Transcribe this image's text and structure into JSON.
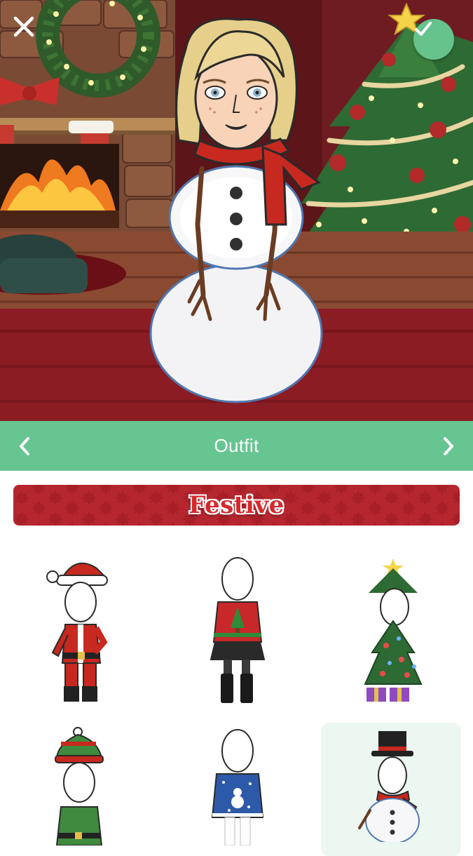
{
  "header": {
    "close_icon": "close-icon",
    "confirm_icon": "checkmark-icon",
    "accent_color": "#66c38b"
  },
  "category_bar": {
    "title": "Outfit",
    "prev_icon": "chevron-left-icon",
    "next_icon": "chevron-right-icon",
    "background": "#66c591"
  },
  "section": {
    "banner_label": "Festive",
    "banner_color": "#b5262e"
  },
  "outfits": [
    {
      "name": "santa-suit",
      "selected": false
    },
    {
      "name": "ugly-christmas-sweater-skirt",
      "selected": false
    },
    {
      "name": "christmas-tree-costume",
      "selected": false
    },
    {
      "name": "elf-costume",
      "selected": false
    },
    {
      "name": "snowman-sweater",
      "selected": false
    },
    {
      "name": "snowman-costume",
      "selected": true
    }
  ]
}
